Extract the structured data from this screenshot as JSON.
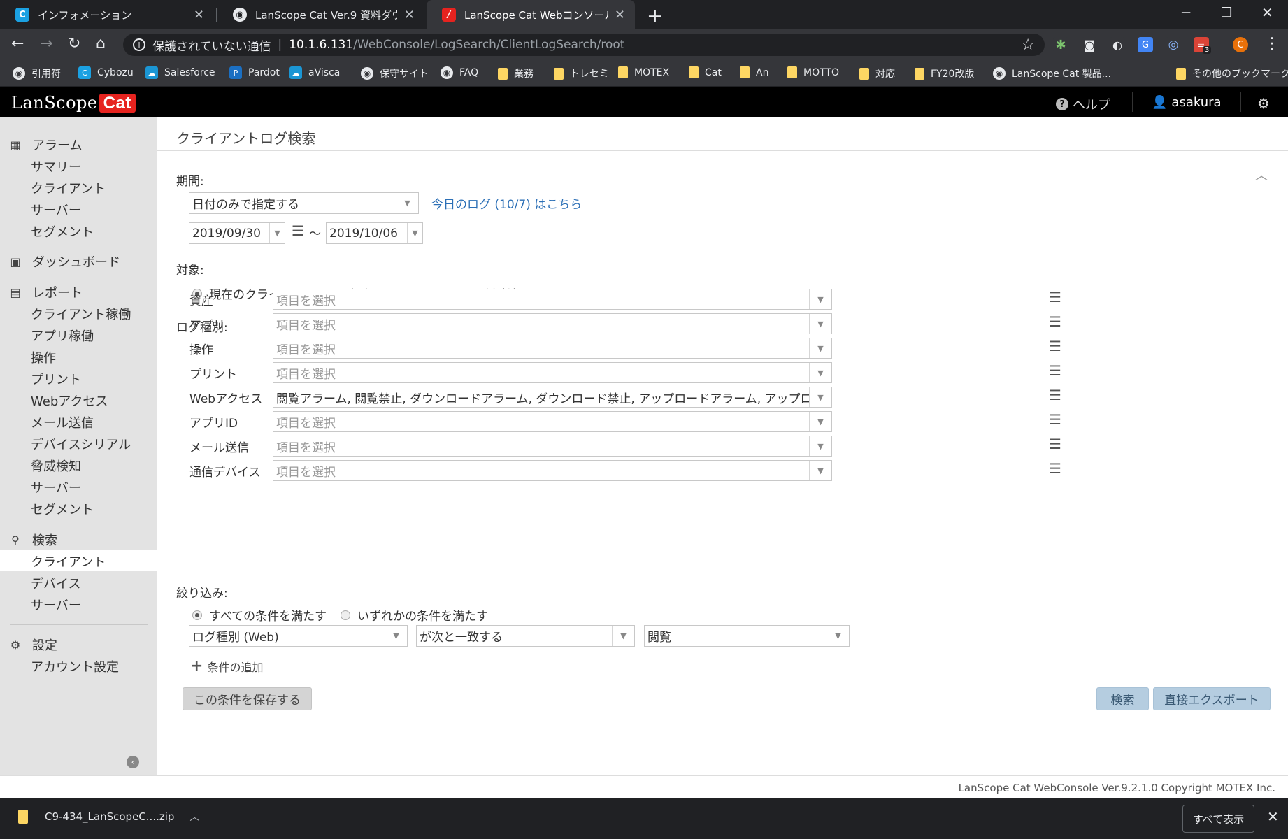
{
  "browser": {
    "tabs": [
      {
        "title": "インフォメーション",
        "icon": "C",
        "icon_color": "#1ba1e2"
      },
      {
        "title": "LanScope Cat Ver.9 資料ダウンロー",
        "icon": "◉",
        "icon_color": "#e8eaed"
      },
      {
        "title": "LanScope Cat Webコンソール - クラ",
        "icon": "/",
        "icon_color": "#e6231f"
      }
    ],
    "address": {
      "security_text": "保護されていない通信",
      "host": "10.1.6.131",
      "path": "/WebConsole/LogSearch/ClientLogSearch/root"
    },
    "extension_badge": "3",
    "profile_initial": "C",
    "bookmarks": [
      {
        "label": "引用符",
        "kind": "globe"
      },
      {
        "label": "Cybozu",
        "kind": "app",
        "icon_text": "C",
        "icon_color": "#1ba1e2"
      },
      {
        "label": "Salesforce",
        "kind": "app",
        "icon_text": "☁",
        "icon_color": "#1b96d4"
      },
      {
        "label": "Pardot",
        "kind": "app",
        "icon_text": "P",
        "icon_color": "#1b6fc2"
      },
      {
        "label": "aVisca",
        "kind": "app",
        "icon_text": "☁",
        "icon_color": "#1b96d4"
      },
      {
        "label": "保守サイト",
        "kind": "globe"
      },
      {
        "label": "FAQ",
        "kind": "globe"
      },
      {
        "label": "業務",
        "kind": "folder"
      },
      {
        "label": "トレセミ",
        "kind": "folder"
      },
      {
        "label": "MOTEX",
        "kind": "folder"
      },
      {
        "label": "Cat",
        "kind": "folder"
      },
      {
        "label": "An",
        "kind": "folder"
      },
      {
        "label": "MOTTO",
        "kind": "folder"
      },
      {
        "label": "対応",
        "kind": "folder"
      },
      {
        "label": "FY20改版",
        "kind": "folder"
      },
      {
        "label": "LanScope Cat 製品...",
        "kind": "globe"
      },
      {
        "label": "その他のブックマーク",
        "kind": "folder"
      }
    ]
  },
  "app": {
    "logo_text": "LanScope",
    "logo_badge": "Cat",
    "help_label": "ヘルプ",
    "user_name": "asakura"
  },
  "sidebar": {
    "alarm": {
      "label": "アラーム",
      "items": [
        "サマリー",
        "クライアント",
        "サーバー",
        "セグメント"
      ]
    },
    "dashboard": {
      "label": "ダッシュボード"
    },
    "report": {
      "label": "レポート",
      "items": [
        "クライアント稼働",
        "アプリ稼働",
        "操作",
        "プリント",
        "Webアクセス",
        "メール送信",
        "デバイスシリアル",
        "脅威検知",
        "サーバー",
        "セグメント"
      ]
    },
    "search": {
      "label": "検索",
      "items": [
        "クライアント",
        "デバイス",
        "サーバー"
      ],
      "selected": "クライアント"
    },
    "settings": {
      "label": "設定",
      "items": [
        "アカウント設定"
      ]
    }
  },
  "main": {
    "title": "クライアントログ検索",
    "period": {
      "label": "期間:",
      "mode": "日付のみで指定する",
      "today_link": "今日のログ (10/7) はこちら",
      "from": "2019/09/30",
      "tilde": "〜",
      "to": "2019/10/06"
    },
    "target": {
      "label": "対象:",
      "options": [
        "現在のクライアント",
        "当時のクライアント",
        "削除済みクライアント"
      ],
      "selected": 0
    },
    "logtype": {
      "label": "ログ種別:",
      "placeholder": "項目を選択",
      "rows": [
        {
          "label": "資産",
          "value": ""
        },
        {
          "label": "アプリ",
          "value": ""
        },
        {
          "label": "操作",
          "value": ""
        },
        {
          "label": "プリント",
          "value": ""
        },
        {
          "label": "Webアクセス",
          "value": "閲覧アラーム, 閲覧禁止, ダウンロードアラーム, ダウンロード禁止, アップロードアラーム, アップロード禁止"
        },
        {
          "label": "アプリID",
          "value": ""
        },
        {
          "label": "メール送信",
          "value": ""
        },
        {
          "label": "通信デバイス",
          "value": ""
        }
      ]
    },
    "filter": {
      "label": "絞り込み:",
      "options": [
        "すべての条件を満たす",
        "いずれかの条件を満たす"
      ],
      "selected": 0,
      "field": "ログ種別 (Web)",
      "operator": "が次と一致する",
      "value": "閲覧",
      "add_label": "条件の追加"
    },
    "buttons": {
      "save": "この条件を保存する",
      "search": "検索",
      "export": "直接エクスポート"
    }
  },
  "footer": {
    "copyright": "LanScope Cat WebConsole Ver.9.2.1.0 Copyright MOTEX Inc."
  },
  "download": {
    "filename": "C9-434_LanScopeC....zip",
    "show_all": "すべて表示"
  }
}
